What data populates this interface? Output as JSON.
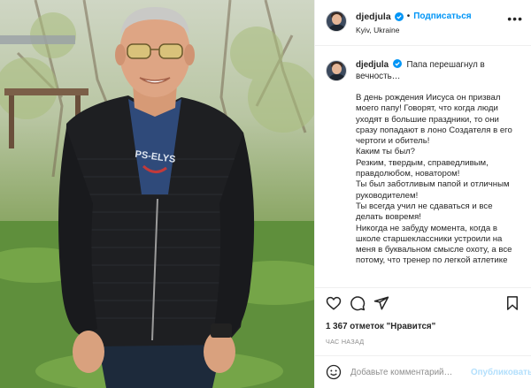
{
  "post": {
    "author": {
      "username": "djedjula",
      "verified": true,
      "location": "Kyiv, Ukraine",
      "avatar_icon": "user-avatar"
    },
    "header": {
      "separator": "•",
      "follow_label": "Подписаться",
      "more_icon": "more-horizontal-icon"
    },
    "caption": {
      "first_line": "Папа перешагнул в вечность…",
      "body": "В день рождения Иисуса он призвал моего папу! Говорят, что когда люди уходят в большие праздники, то они сразу попадают в лоно Создателя в его чертоги и обитель!\nКаким ты был?\nРезким, твердым, справедливым, правдолюбом, новатором!\nТы был заботливым папой и отличным руководителем!\nТы всегда учил не сдаваться и все делать вовремя!\nНикогда не забуду момента, когда в школе старшеклассники устроили на меня в буквальном смысле охоту, а все потому, что тренер по легкой атлетике"
    },
    "actions": {
      "like_icon": "heart-icon",
      "comment_icon": "comment-icon",
      "share_icon": "paper-plane-icon",
      "save_icon": "bookmark-icon"
    },
    "likes_text": "1 367 отметок \"Нравится\"",
    "timestamp": "ЧАС НАЗАД",
    "comment_box": {
      "emoji_icon": "emoji-icon",
      "placeholder": "Добавьте комментарий…",
      "publish_label": "Опубликовать"
    },
    "photo": {
      "shirt_print": "PS-ELYS"
    },
    "colors": {
      "accent": "#0095f6",
      "publish_disabled": "#b2dffc",
      "text": "#262626",
      "muted": "#8e8e8e",
      "border": "#efefef"
    }
  }
}
